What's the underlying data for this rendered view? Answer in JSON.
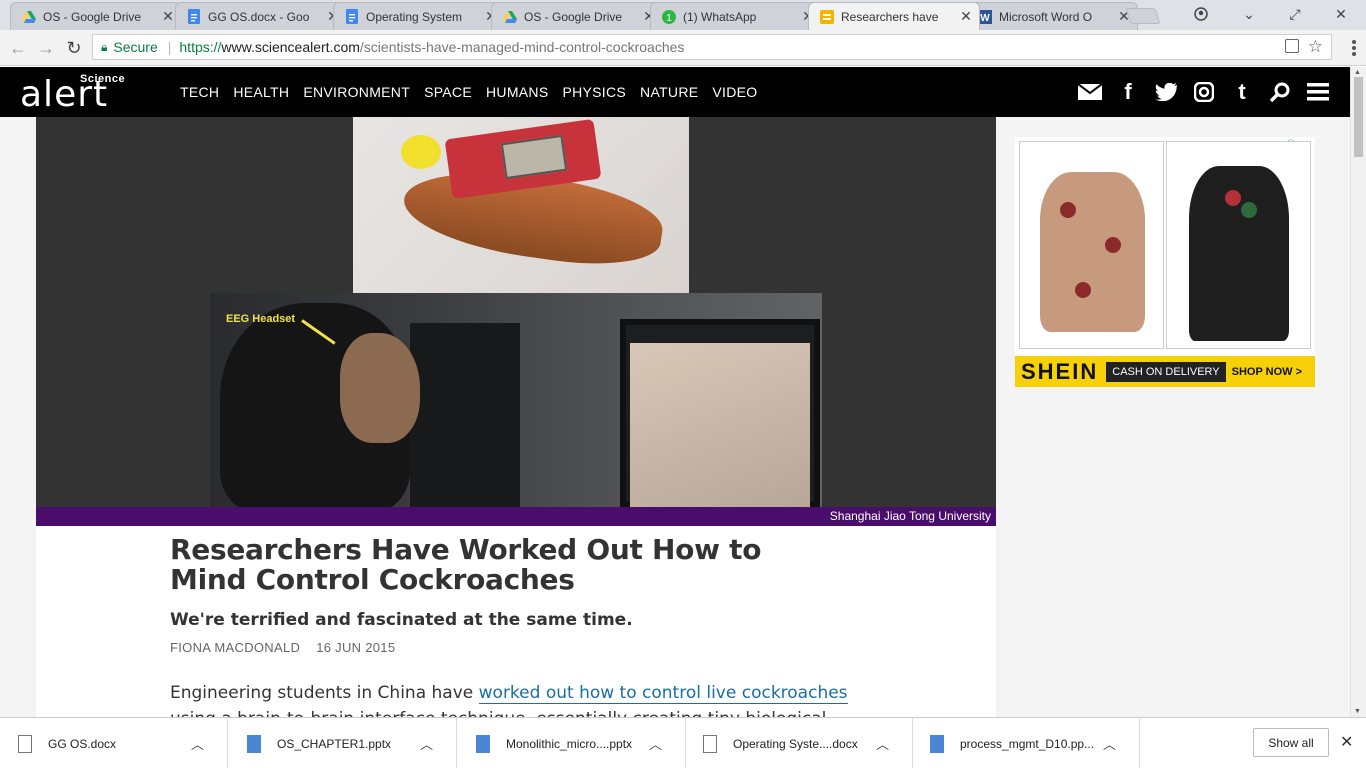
{
  "browser": {
    "tabs": [
      {
        "title": "OS - Google Drive",
        "icon": "google-drive-icon",
        "active": false
      },
      {
        "title": "GG OS.docx - Goo",
        "icon": "google-docs-icon",
        "active": false
      },
      {
        "title": "Operating System",
        "icon": "google-docs-icon",
        "active": false
      },
      {
        "title": "OS - Google Drive",
        "icon": "google-drive-icon",
        "active": false
      },
      {
        "title": "(1) WhatsApp",
        "icon": "whatsapp-icon",
        "active": false
      },
      {
        "title": "Researchers have",
        "icon": "sciencealert-icon",
        "active": true
      },
      {
        "title": "Microsoft Word O",
        "icon": "word-icon",
        "active": false
      }
    ],
    "address": {
      "secure_label": "Secure",
      "scheme": "https://",
      "host": "www.sciencealert.com",
      "path": "/scientists-have-managed-mind-control-cockroaches"
    }
  },
  "site": {
    "logo_small": "Science",
    "logo_big": "alert",
    "nav": [
      "TECH",
      "HEALTH",
      "ENVIRONMENT",
      "SPACE",
      "HUMANS",
      "PHYSICS",
      "NATURE",
      "VIDEO"
    ],
    "socials": [
      "mail-icon",
      "facebook-icon",
      "twitter-icon",
      "instagram-icon",
      "tumblr-icon",
      "search-icon",
      "hamburger-menu-icon"
    ]
  },
  "article": {
    "hero_label": "EEG Headset",
    "image_credit": "Shanghai Jiao Tong University",
    "title": "Researchers Have Worked Out How to Mind Control Cockroaches",
    "subtitle": "We're terrified and fascinated at the same time.",
    "author": "FIONA MACDONALD",
    "date": "16 JUN 2015",
    "para_start": "Engineering students in China have ",
    "para_link": "worked out how to control live cockroaches",
    "para_end": " using a brain-to-brain interface technique, essentially creating tiny biological"
  },
  "ad": {
    "brand": "SHEIN",
    "cta1": "CASH ON DELIVERY",
    "cta2": "SHOP NOW >"
  },
  "downloads": {
    "items": [
      {
        "name": "GG OS.docx",
        "type": "doc"
      },
      {
        "name": "OS_CHAPTER1.pptx",
        "type": "ppt"
      },
      {
        "name": "Monolithic_micro....pptx",
        "type": "ppt"
      },
      {
        "name": "Operating Syste....docx",
        "type": "doc"
      },
      {
        "name": "process_mgmt_D10.pp...",
        "type": "ppt"
      }
    ],
    "show_all": "Show all"
  }
}
